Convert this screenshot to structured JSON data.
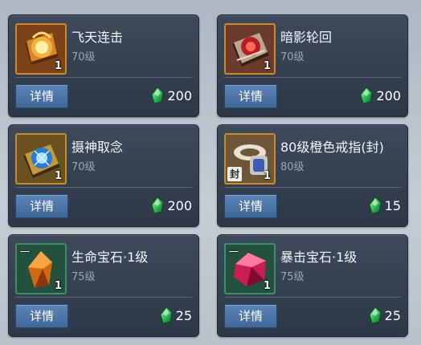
{
  "items": [
    {
      "name": "飞天连击",
      "level": "70级",
      "qty": "1",
      "price": "200",
      "detail": "详情",
      "badge": "",
      "bind": ""
    },
    {
      "name": "暗影轮回",
      "level": "70级",
      "qty": "1",
      "price": "200",
      "detail": "详情",
      "badge": "",
      "bind": ""
    },
    {
      "name": "摄神取念",
      "level": "70级",
      "qty": "1",
      "price": "200",
      "detail": "详情",
      "badge": "",
      "bind": ""
    },
    {
      "name": "80级橙色戒指(封)",
      "level": "80级",
      "qty": "1",
      "price": "15",
      "detail": "详情",
      "badge": "",
      "bind": "封"
    },
    {
      "name": "生命宝石·1级",
      "level": "75级",
      "qty": "1",
      "price": "25",
      "detail": "详情",
      "badge": "一",
      "bind": ""
    },
    {
      "name": "暴击宝石·1级",
      "level": "75级",
      "qty": "1",
      "price": "25",
      "detail": "详情",
      "badge": "一",
      "bind": ""
    }
  ],
  "colors": {
    "card_bg": "#34404f",
    "orange_frame": "#c88a2c",
    "green_frame": "#3e8f68",
    "button": "#4f76a8",
    "currency_gem": "#2fbf5a"
  },
  "icons": [
    "skill-book-fire-icon",
    "skill-book-red-icon",
    "skill-book-blue-icon",
    "ring-icon",
    "orange-gem-icon",
    "red-gem-icon",
    "green-gem-currency-icon"
  ]
}
